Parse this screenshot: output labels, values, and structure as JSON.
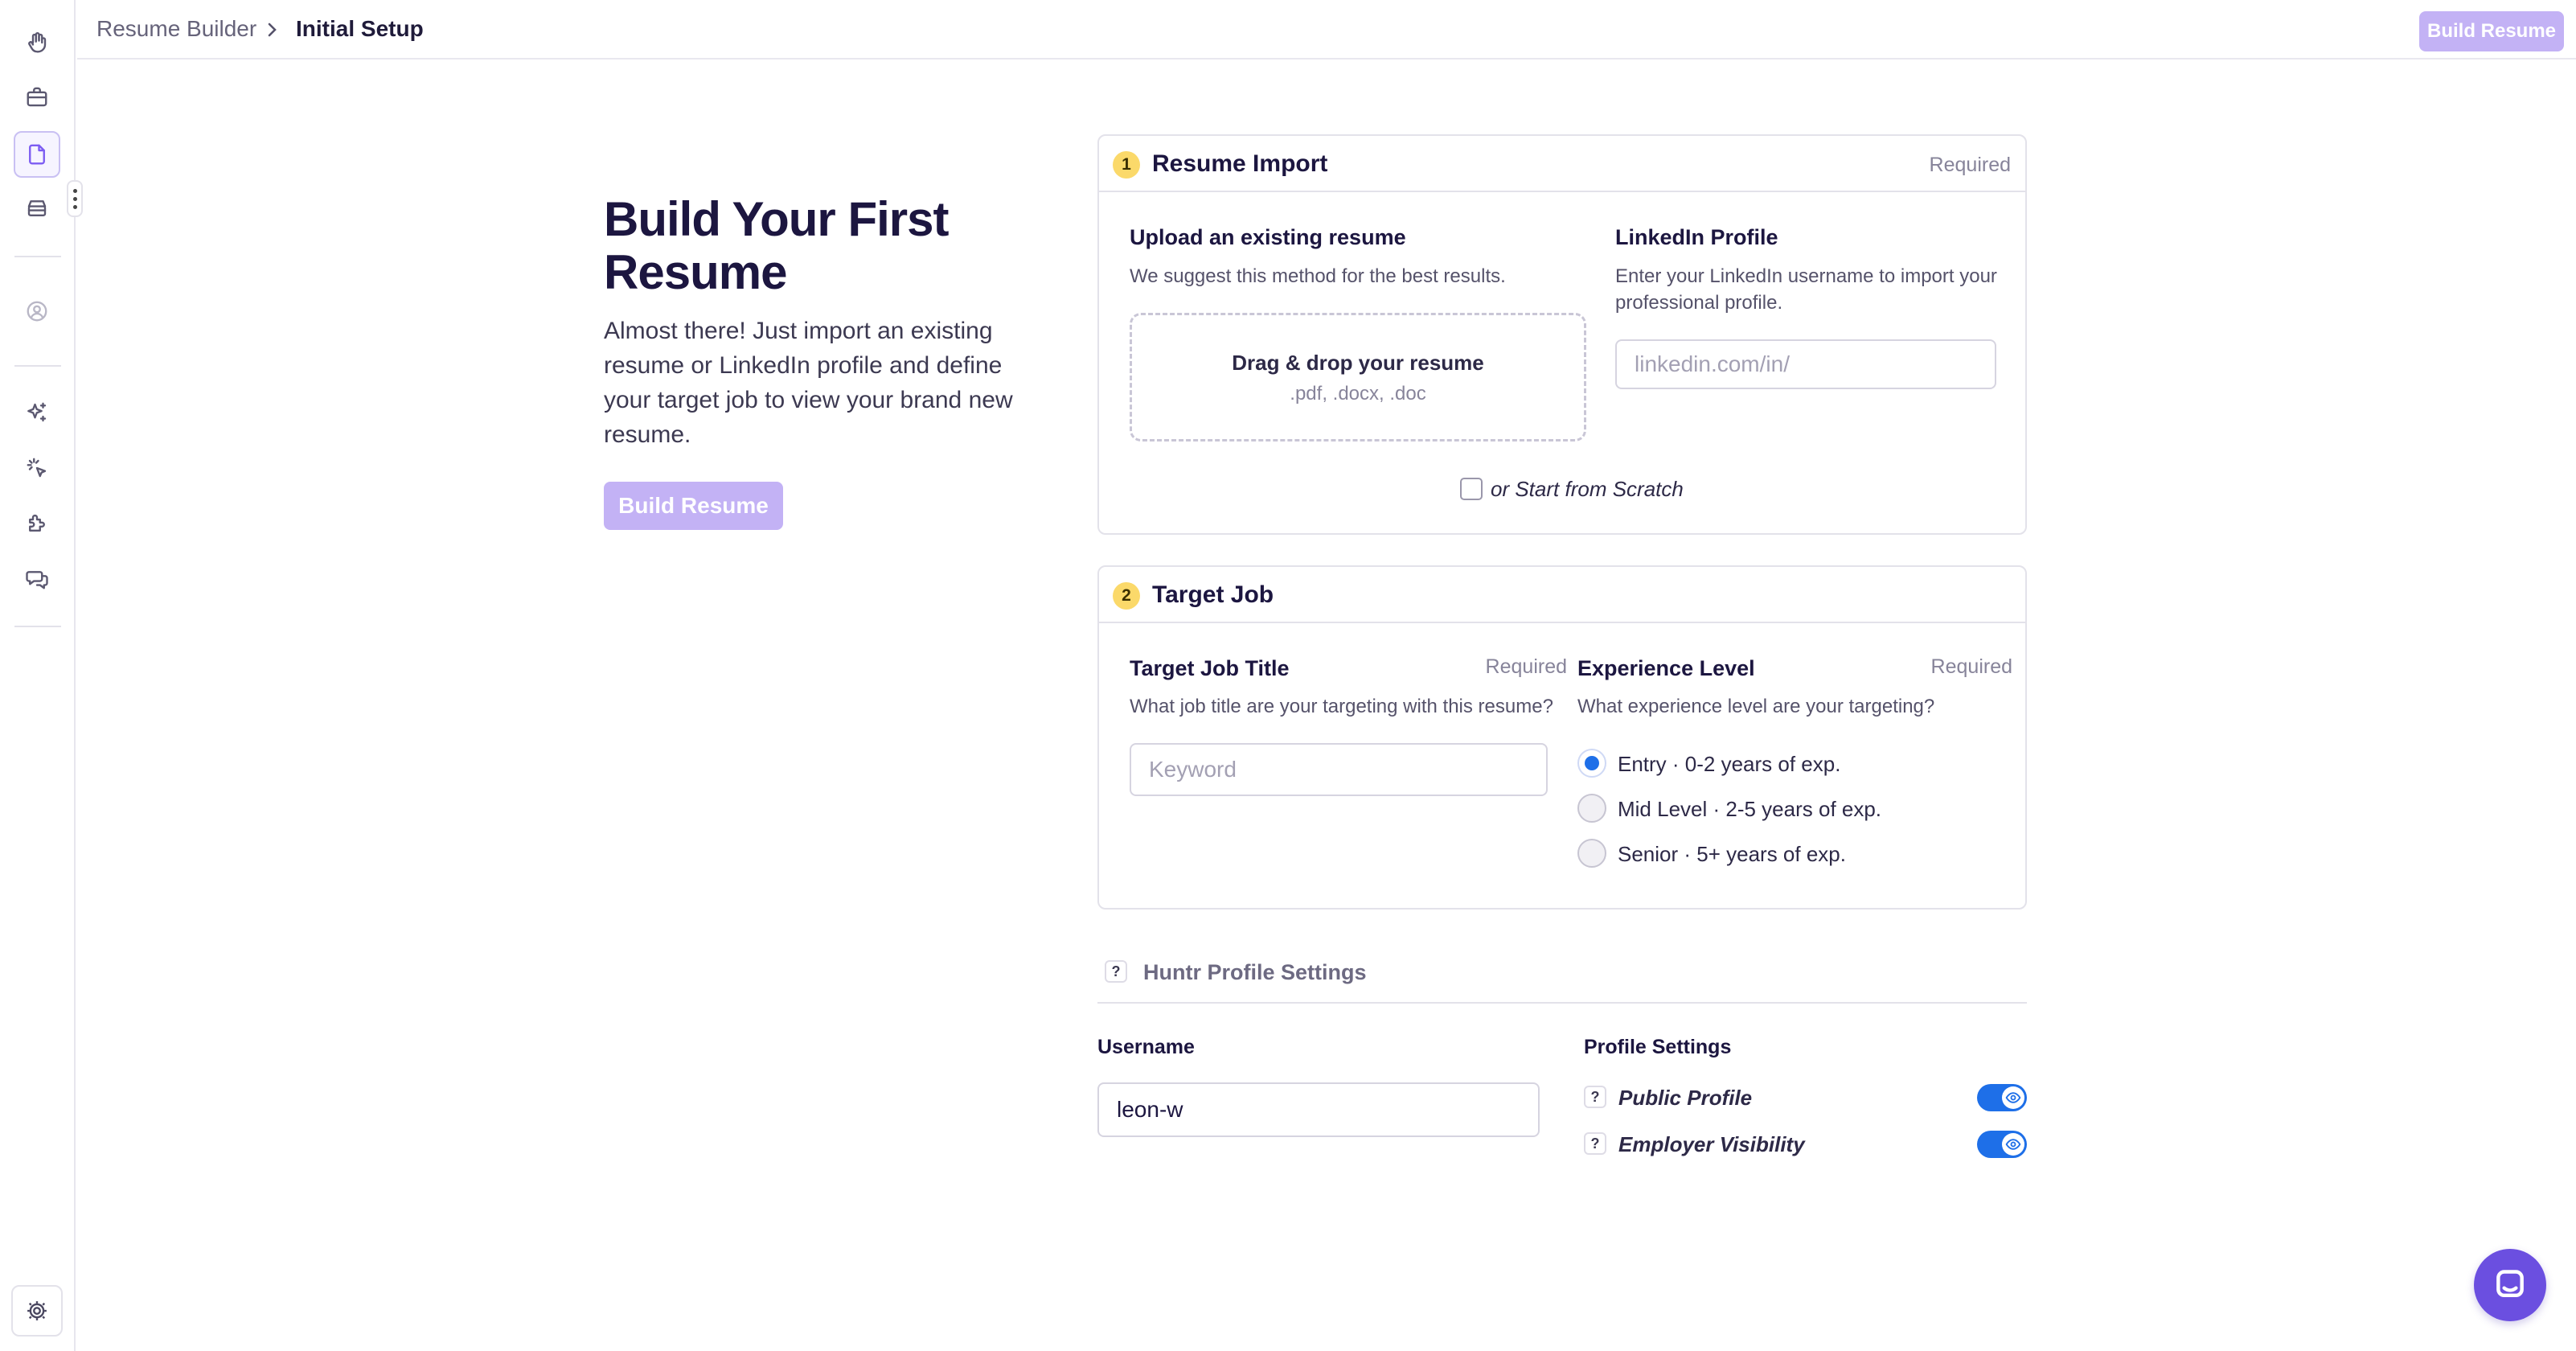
{
  "breadcrumb": {
    "root": "Resume Builder",
    "current": "Initial Setup"
  },
  "topbar": {
    "build_label": "Build Resume"
  },
  "sidebar": {
    "icons": [
      "hand-icon",
      "briefcase-icon",
      "document-icon",
      "archive-icon",
      "user-circle-icon",
      "sparkles-icon",
      "cursor-click-icon",
      "puzzle-icon",
      "chat-bubbles-icon",
      "gear-icon"
    ],
    "active": "document-icon"
  },
  "intro": {
    "title": "Build Your First Resume",
    "text": "Almost there! Just import an existing resume or LinkedIn profile and define your target job to view your brand new resume.",
    "build_label": "Build Resume"
  },
  "resume_import": {
    "step": "1",
    "title": "Resume Import",
    "required": "Required",
    "upload": {
      "label": "Upload an existing resume",
      "help": "We suggest this method for the best results.",
      "drop_title": "Drag & drop your resume",
      "drop_types": ".pdf, .docx, .doc"
    },
    "linkedin": {
      "label": "LinkedIn Profile",
      "help": "Enter your LinkedIn username to import your professional profile.",
      "placeholder": "linkedin.com/in/",
      "value": ""
    },
    "scratch_label": "or Start from Scratch",
    "scratch_checked": false
  },
  "target_job": {
    "step": "2",
    "title": "Target Job",
    "job_title": {
      "label": "Target Job Title",
      "required": "Required",
      "help": "What job title are your targeting with this resume?",
      "placeholder": "Keyword",
      "value": ""
    },
    "experience": {
      "label": "Experience Level",
      "required": "Required",
      "help": "What experience level are your targeting?",
      "options": [
        "Entry · 0-2 years of exp.",
        "Mid Level · 2-5 years of exp.",
        "Senior · 5+ years of exp."
      ],
      "selected": "Entry · 0-2 years of exp."
    }
  },
  "profile_settings": {
    "section_title": "Huntr Profile Settings",
    "help_glyph": "?",
    "username": {
      "label": "Username",
      "value": "leon-w"
    },
    "settings_label": "Profile Settings",
    "public_profile": {
      "label": "Public Profile",
      "enabled": true
    },
    "employer_visibility": {
      "label": "Employer Visibility",
      "enabled": true
    }
  },
  "colors": {
    "accent": "#7c5cf2",
    "button_disabled": "#c3b2f5",
    "toggle_on": "#1e6fe8",
    "step_badge": "#fbd96a"
  }
}
